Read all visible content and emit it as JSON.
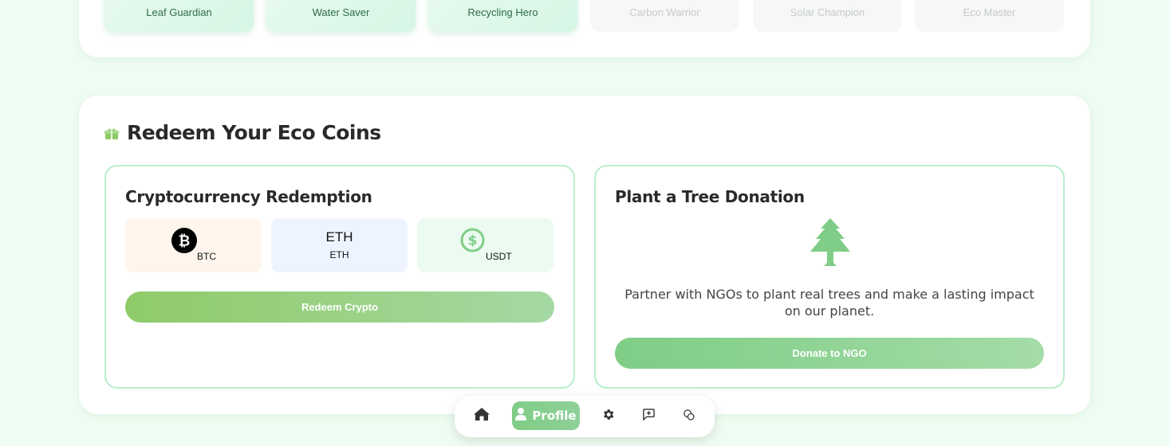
{
  "badges": [
    {
      "label": "Leaf Guardian",
      "status": "earned"
    },
    {
      "label": "Water Saver",
      "status": "earned"
    },
    {
      "label": "Recycling Hero",
      "status": "earned"
    },
    {
      "label": "Carbon Warrior",
      "status": "locked"
    },
    {
      "label": "Solar Champion",
      "status": "locked"
    },
    {
      "label": "Eco Master",
      "status": "locked"
    }
  ],
  "redeem": {
    "title": "Redeem Your Eco Coins",
    "title_icon": "gift-icon",
    "crypto": {
      "title": "Cryptocurrency Redemption",
      "coins": [
        {
          "symbol": "BTC",
          "icon": "bitcoin-icon"
        },
        {
          "symbol": "ETH",
          "icon_text": "ETH"
        },
        {
          "symbol": "USDT",
          "icon": "dollar-circle-icon"
        }
      ],
      "button_label": "Redeem Crypto"
    },
    "tree": {
      "title": "Plant a Tree Donation",
      "icon": "tree-icon",
      "description": "Partner with NGOs to plant real trees and make a lasting impact on our planet.",
      "button_label": "Donate to NGO"
    }
  },
  "nav": {
    "items": [
      {
        "name": "home",
        "icon": "home-icon"
      },
      {
        "name": "profile",
        "icon": "user-icon",
        "label": "Profile",
        "active": true
      },
      {
        "name": "settings",
        "icon": "gear-icon"
      },
      {
        "name": "feedback",
        "icon": "message-plus-icon"
      },
      {
        "name": "coins",
        "icon": "coins-icon"
      }
    ]
  },
  "colors": {
    "background": "#eefcf1",
    "accent_green": "#7fcd86",
    "panel_border": "#b8efcb"
  }
}
